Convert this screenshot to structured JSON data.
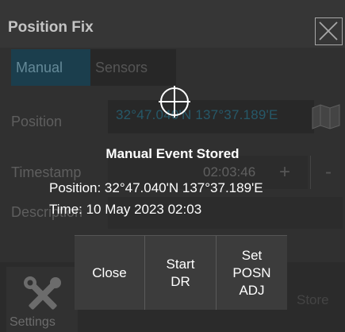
{
  "window": {
    "title": "Position Fix",
    "close_icon": "close-x-icon"
  },
  "tabs": [
    {
      "label": "Manual",
      "active": true
    },
    {
      "label": "Sensors",
      "active": false
    }
  ],
  "form": {
    "position_label": "Position",
    "position_value": "32°47.040'N 137°37.189'E",
    "timestamp_label": "Timestamp",
    "timestamp_value": "02:03:46",
    "plus_label": "+",
    "minus_label": "-",
    "description_label": "Description"
  },
  "bottom_bar": {
    "settings_label": "Settings",
    "settings_icon": "tools-icon",
    "store_label": "Store"
  },
  "modal": {
    "icon": "crosshair-icon",
    "title": "Manual Event Stored",
    "position_line": "Position: 32°47.040'N 137°37.189'E",
    "time_line": "Time: 10 May 2023 02:03",
    "buttons": {
      "close": "Close",
      "start_dr": "Start\nDR",
      "set_posn_adj": "Set\nPOSN\nADJ"
    }
  },
  "colors": {
    "active_tab": "#1e4d60",
    "active_tab_text": "#7fb0c4",
    "position_text": "#2d6f85"
  }
}
